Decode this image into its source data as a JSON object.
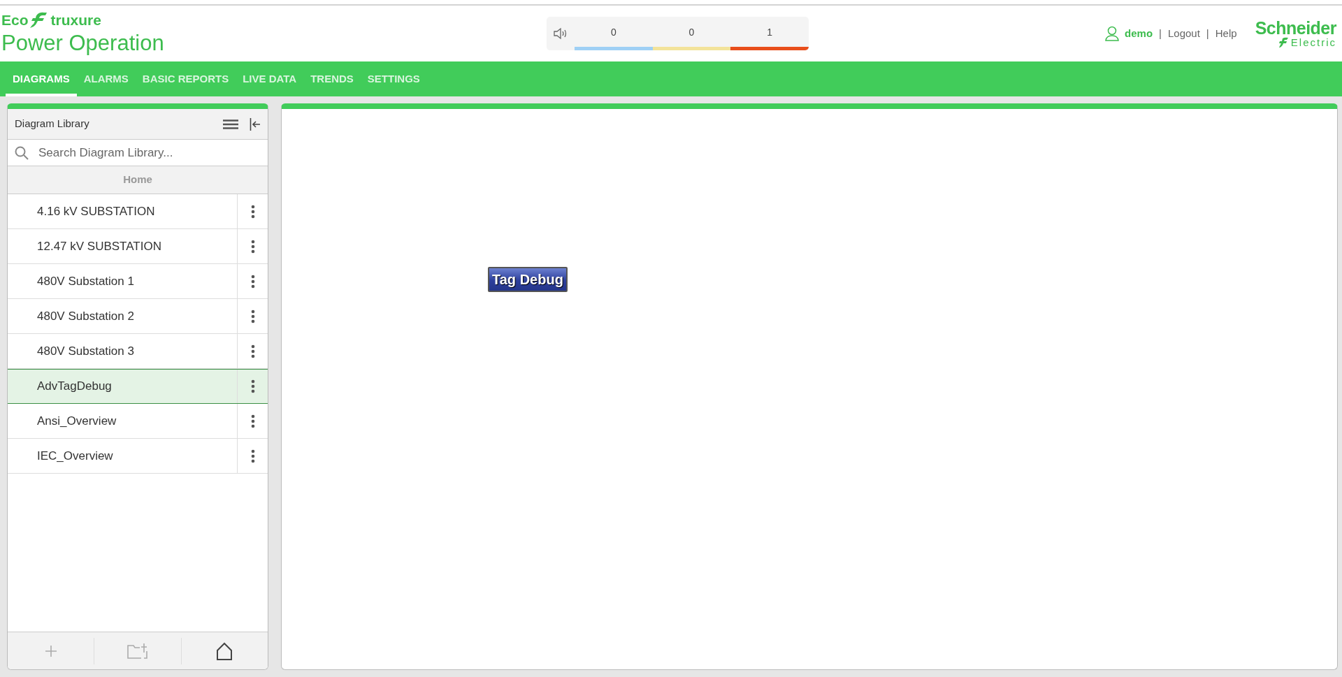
{
  "brand": {
    "logo_left": "Eco",
    "logo_right": "truxure",
    "app_name": "Power Operation"
  },
  "alarm_banner": {
    "counts": [
      {
        "value": "0",
        "color": "#9fd0f5"
      },
      {
        "value": "0",
        "color": "#f3e39a"
      },
      {
        "value": "1",
        "color": "#e84e1b"
      }
    ]
  },
  "user_menu": [
    {
      "kind": "username",
      "text": "demo"
    },
    {
      "kind": "separator",
      "text": "|"
    },
    {
      "kind": "link",
      "text": "Logout"
    },
    {
      "kind": "separator",
      "text": "|"
    },
    {
      "kind": "link",
      "text": "Help"
    }
  ],
  "vendor_logo": {
    "line1": "Schneider",
    "line2": "Electric"
  },
  "nav_tabs": [
    {
      "label": "DIAGRAMS",
      "selected": true
    },
    {
      "label": "ALARMS",
      "selected": false
    },
    {
      "label": "BASIC REPORTS",
      "selected": false
    },
    {
      "label": "LIVE DATA",
      "selected": false
    },
    {
      "label": "TRENDS",
      "selected": false
    },
    {
      "label": "SETTINGS",
      "selected": false
    }
  ],
  "sidebar": {
    "title": "Diagram Library",
    "search": {
      "placeholder": "Search Diagram Library..."
    },
    "breadcrumb": "Home",
    "items": [
      {
        "label": "4.16 kV SUBSTATION",
        "selected": false
      },
      {
        "label": "12.47 kV SUBSTATION",
        "selected": false
      },
      {
        "label": "480V Substation 1",
        "selected": false
      },
      {
        "label": "480V Substation 2",
        "selected": false
      },
      {
        "label": "480V Substation 3",
        "selected": false
      },
      {
        "label": "AdvTagDebug",
        "selected": true
      },
      {
        "label": "Ansi_Overview",
        "selected": false
      },
      {
        "label": "IEC_Overview",
        "selected": false
      }
    ],
    "footer_buttons": [
      {
        "kind": "add",
        "disabled": true
      },
      {
        "kind": "new-folder",
        "disabled": true
      },
      {
        "kind": "home",
        "disabled": false
      }
    ]
  },
  "canvas": {
    "buttons": [
      "Tag Debug"
    ]
  }
}
